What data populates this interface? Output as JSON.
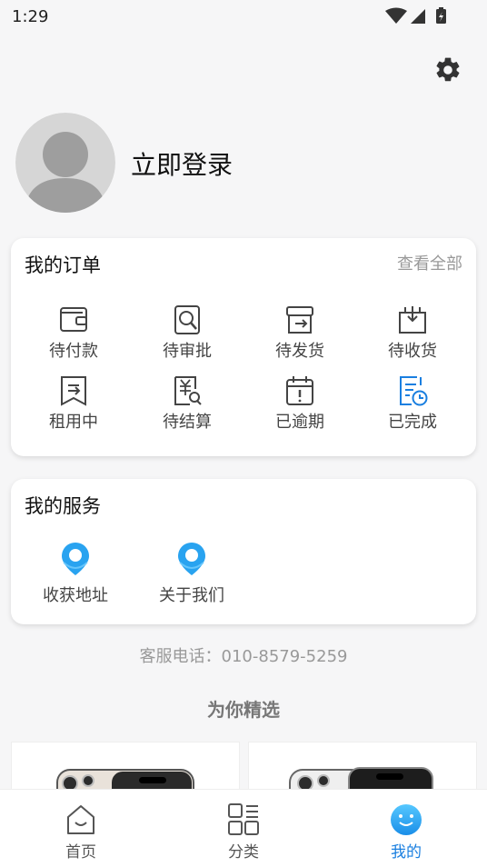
{
  "status_bar": {
    "time": "1:29"
  },
  "profile": {
    "login_label": "立即登录"
  },
  "orders": {
    "title": "我的订单",
    "view_all": "查看全部",
    "items": [
      {
        "label": "待付款",
        "icon": "wallet-icon"
      },
      {
        "label": "待审批",
        "icon": "review-icon"
      },
      {
        "label": "待发货",
        "icon": "ship-icon"
      },
      {
        "label": "待收货",
        "icon": "receive-icon"
      },
      {
        "label": "租用中",
        "icon": "bookmark-icon"
      },
      {
        "label": "待结算",
        "icon": "settle-icon"
      },
      {
        "label": "已逾期",
        "icon": "calendar-alert-icon"
      },
      {
        "label": "已完成",
        "icon": "completed-icon"
      }
    ]
  },
  "services": {
    "title": "我的服务",
    "items": [
      {
        "label": "收获地址",
        "icon": "location-pin-icon"
      },
      {
        "label": "关于我们",
        "icon": "location-pin-icon"
      }
    ]
  },
  "hotline": {
    "label": "客服电话：",
    "number": "010-8579-5259"
  },
  "picks": {
    "title": "为你精选"
  },
  "bottom_nav": {
    "items": [
      {
        "label": "首页",
        "icon": "home-icon"
      },
      {
        "label": "分类",
        "icon": "category-icon"
      },
      {
        "label": "我的",
        "icon": "profile-face-icon",
        "active": true
      }
    ]
  },
  "colors": {
    "accent": "#1a7fe0",
    "icon_gray": "#444444",
    "pin_blue": "#29a3f0"
  }
}
